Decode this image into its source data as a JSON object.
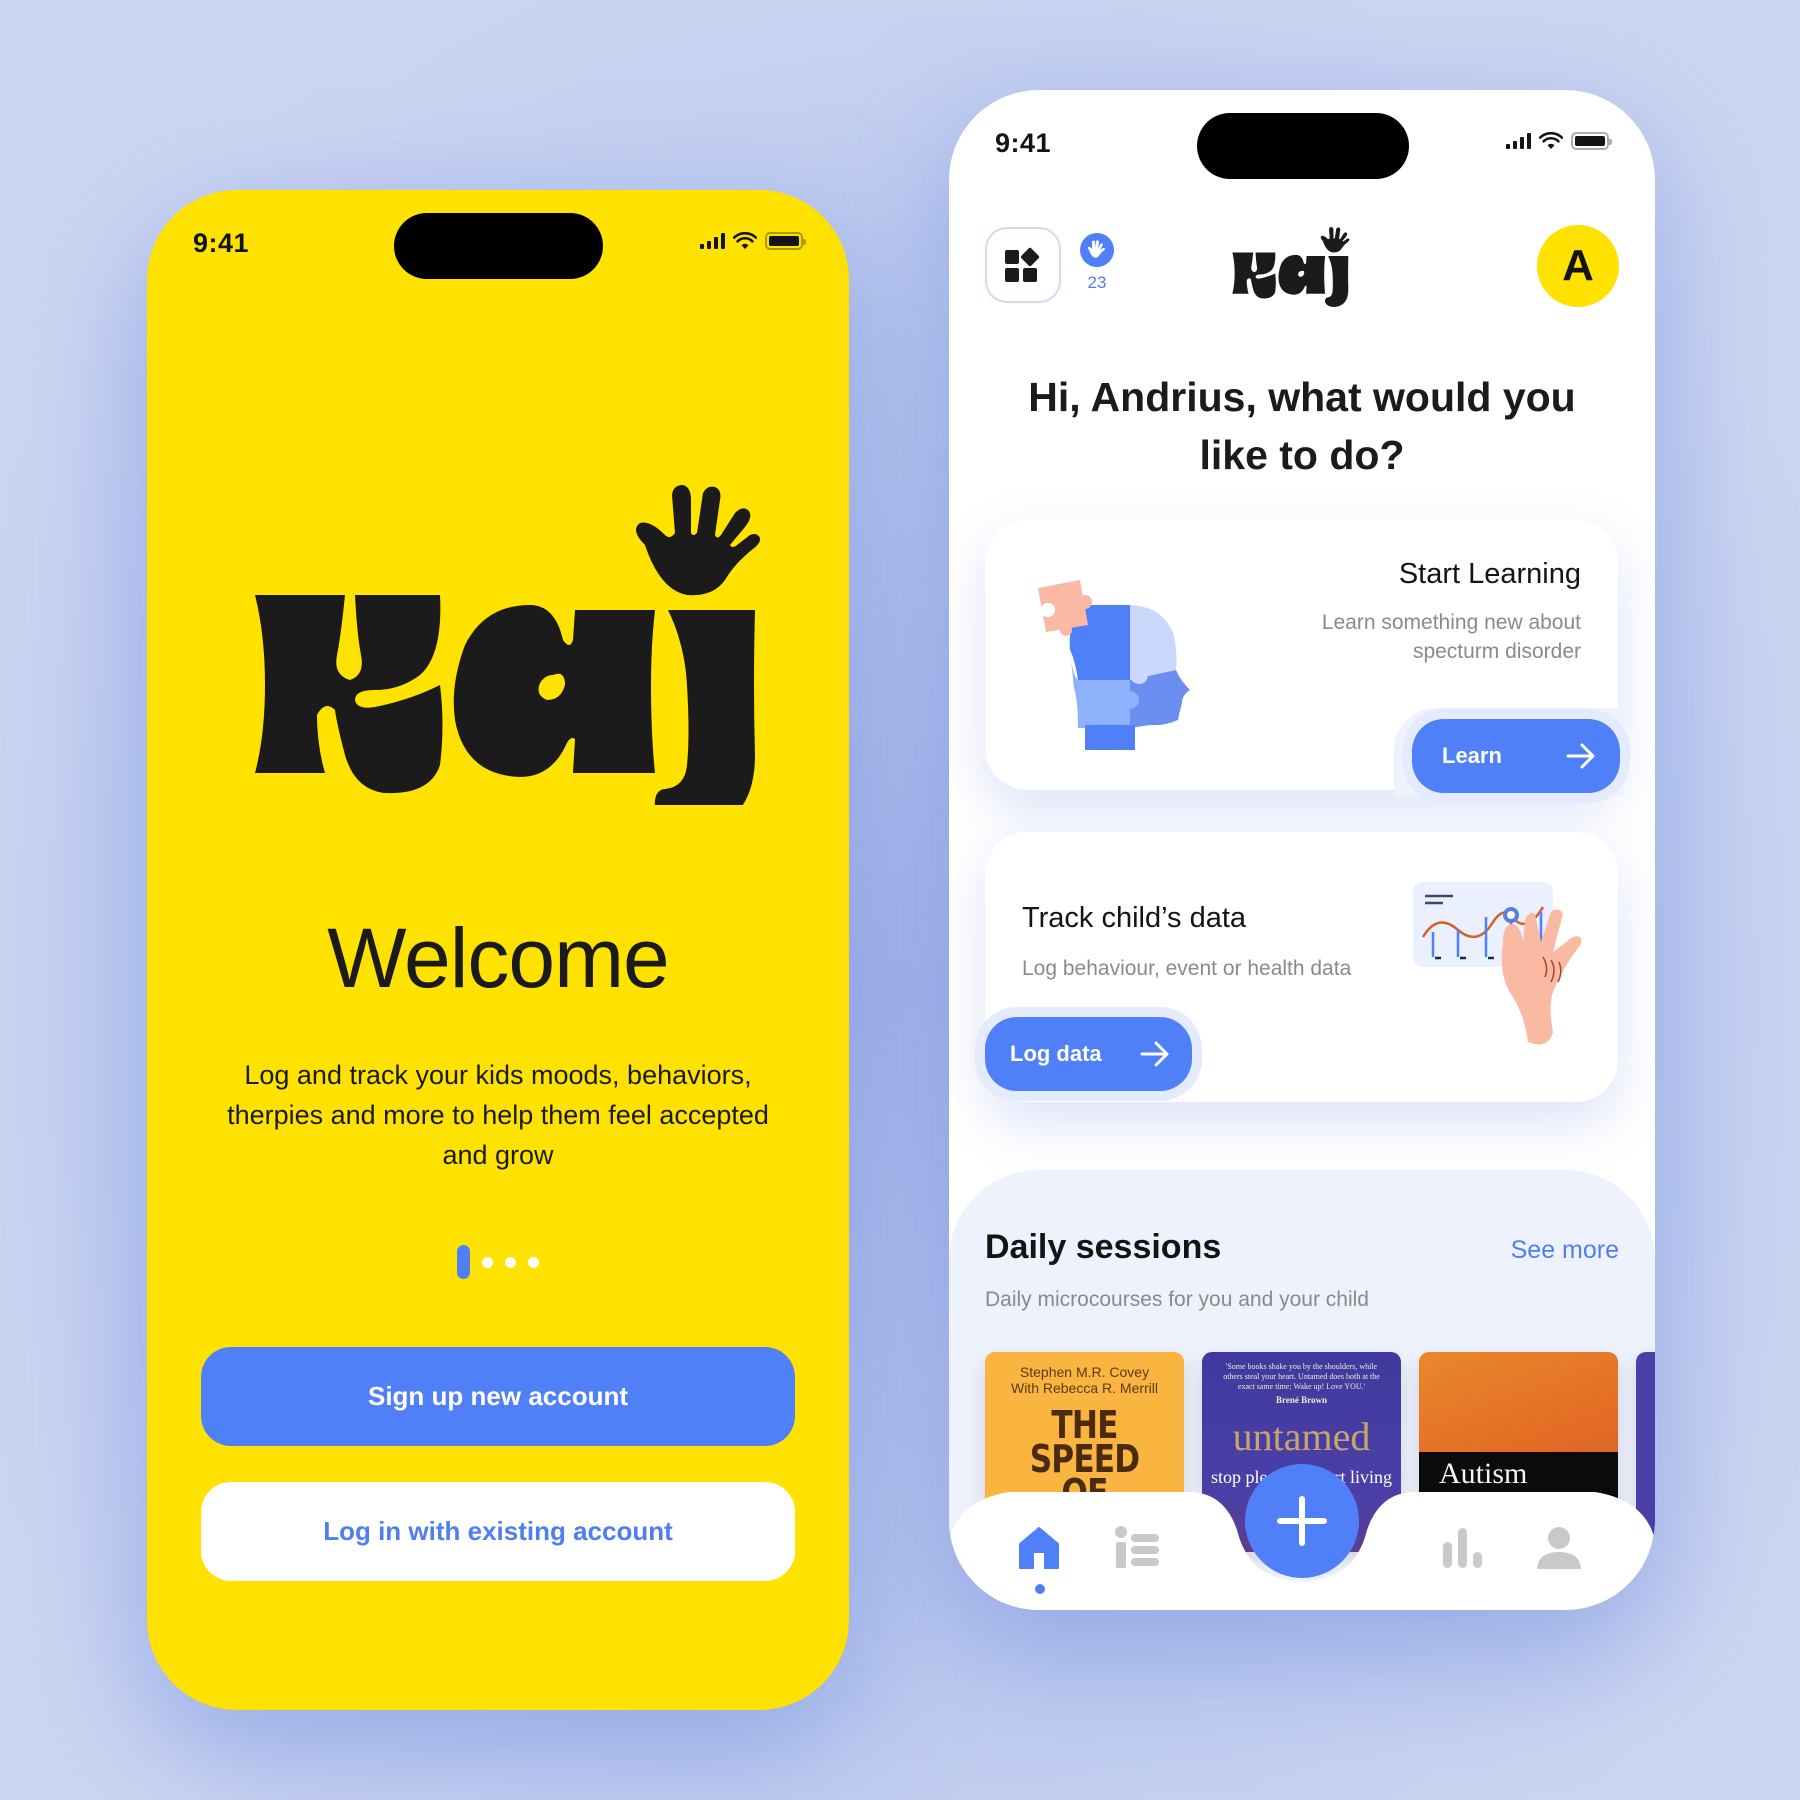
{
  "colors": {
    "background": "#c7d3f2",
    "brand_yellow": "#ffe200",
    "accent_blue": "#4f80f8",
    "text_dark": "#141414",
    "text_muted": "#8a8a8a",
    "section_bg": "#eef2fd",
    "skin": "#f9b9a2"
  },
  "welcome_screen": {
    "status_bar": {
      "time": "9:41"
    },
    "brand": "kaj",
    "title": "Welcome",
    "description": "Log and track your kids moods, behaviors, therpies and more to help them feel accepted and grow",
    "pager": {
      "total": 4,
      "active_index": 0
    },
    "buttons": {
      "signup": "Sign up new account",
      "login": "Log in with existing account"
    }
  },
  "home_screen": {
    "status_bar": {
      "time": "9:41"
    },
    "header": {
      "menu_icon": "grid-icon",
      "waves_icon": "wave-hand-icon",
      "waves_count": "23",
      "brand": "kaj",
      "avatar_initial": "A"
    },
    "greeting": {
      "prefix": "Hi, ",
      "name": "Andrius,",
      "suffix": " what would you like to do?"
    },
    "cards": {
      "learning": {
        "title": "Start Learning",
        "subtitle": "Learn something new about specturm disorder",
        "button": "Learn",
        "illustration": "puzzle-head-illustration"
      },
      "tracking": {
        "title": "Track child’s data",
        "subtitle": "Log behaviour, event or health data",
        "button": "Log data",
        "illustration": "chart-hand-illustration"
      }
    },
    "daily_sessions": {
      "title": "Daily sessions",
      "see_more": "See more",
      "subtitle": "Daily microcourses for you and your child",
      "books": [
        {
          "author": "Stephen M.R. Covey\nWith Rebecca R. Merrill",
          "title": "THE SPEED OF TRUST"
        },
        {
          "quote": "'Some books shake you by the shoulders, while others steal your heart. Untamed does both at the exact same time: Wake up! Love YOU.'",
          "author": "Brené Brown",
          "title": "untamed",
          "subtitle": "stop pleasing, start living"
        },
        {
          "title": "Autism"
        }
      ]
    },
    "bottom_nav": {
      "items": [
        {
          "name": "home",
          "icon": "home-icon",
          "active": true
        },
        {
          "name": "list",
          "icon": "list-icon",
          "active": false
        },
        {
          "name": "add",
          "icon": "plus-icon",
          "active": false
        },
        {
          "name": "stats",
          "icon": "bar-chart-icon",
          "active": false
        },
        {
          "name": "profile",
          "icon": "person-icon",
          "active": false
        }
      ]
    }
  }
}
